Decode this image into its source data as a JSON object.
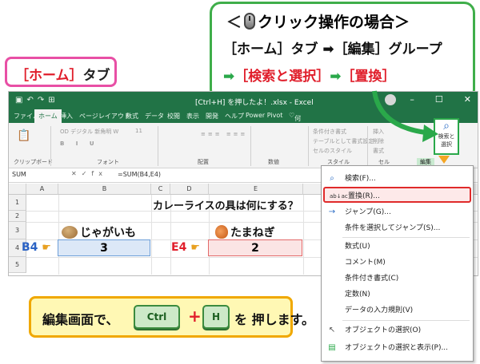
{
  "callout": {
    "line1_left": "＜",
    "line1_title": "クリック操作の場合＞",
    "line2": "［ホーム］タブ ➡［編集］グループ",
    "line3_arrow": "➡",
    "line3_search": "［検索と選択］",
    "line3_arrow2": "➡",
    "line3_replace": "［置換］"
  },
  "home_callout": {
    "bracket_open": "［",
    "home": "ホーム",
    "bracket_close": "］",
    "tab": "タブ"
  },
  "titlebar": {
    "title": "[Ctrl+H] を押したよ！.xlsx  -  Excel",
    "minimize": "–",
    "restore": "☐",
    "close": "✕"
  },
  "tabs": [
    "ファイル",
    "ホーム",
    "挿入",
    "ページレイアウト",
    "数式",
    "データ",
    "校閲",
    "表示",
    "開発",
    "ヘルプ",
    "Power Pivot",
    "実行したい作業を入力してください",
    "何をしますか"
  ],
  "ribbon": {
    "clipboard": "クリップボード",
    "font": "フォント",
    "font_name": "OD デジタル 新角明 W",
    "font_size": "11",
    "align": "配置",
    "number": "数値",
    "styles": "スタイル",
    "cells": "セル",
    "editing": "編集",
    "cond_format": "条件付き書式",
    "table_format": "テーブルとして書式設定",
    "cell_style": "セルのスタイル",
    "insert": "挿入",
    "delete": "削除",
    "format": "書式",
    "search_btn_line1": "検索と",
    "search_btn_line2": "選択"
  },
  "formula_bar": {
    "name_box": "SUM",
    "cancel": "✕",
    "enter": "✓",
    "fx": "fx",
    "formula": "=SUM(B4,E4)"
  },
  "columns": [
    "A",
    "B",
    "C",
    "D",
    "E",
    "F"
  ],
  "rows": [
    "1",
    "2",
    "3",
    "4",
    "5"
  ],
  "sheet": {
    "question": "カレーライスの具は何にする？",
    "item1": "じゃがいも",
    "item2": "たまねぎ",
    "b4_label": "B4",
    "e4_label": "E4",
    "b4_value": "3",
    "e4_value": "2"
  },
  "menu": {
    "items": [
      {
        "icon": "search-icon",
        "label": "検索(F)..."
      },
      {
        "icon": "replace-icon",
        "label": "置換(R)..."
      },
      {
        "icon": "goto-icon",
        "label": "ジャンプ(G)..."
      },
      {
        "icon": "",
        "label": "条件を選択してジャンプ(S)..."
      },
      {
        "icon": "",
        "label": "数式(U)"
      },
      {
        "icon": "",
        "label": "コメント(M)"
      },
      {
        "icon": "",
        "label": "条件付き書式(C)"
      },
      {
        "icon": "",
        "label": "定数(N)"
      },
      {
        "icon": "",
        "label": "データの入力規則(V)"
      },
      {
        "icon": "select-object-icon",
        "label": "オブジェクトの選択(O)"
      },
      {
        "icon": "selection-pane-icon",
        "label": "オブジェクトの選択と表示(P)..."
      }
    ]
  },
  "bottom": {
    "text1": "編集画面で、",
    "key1": "Ctrl",
    "plus": "+",
    "key2": "H",
    "text2": "を 押します。"
  },
  "colors": {
    "excel_green": "#217346",
    "callout_green": "#3fae4a",
    "accent_red": "#e01e2b",
    "home_pink": "#e84fa5",
    "bottom_yellow": "#fff8b4"
  }
}
